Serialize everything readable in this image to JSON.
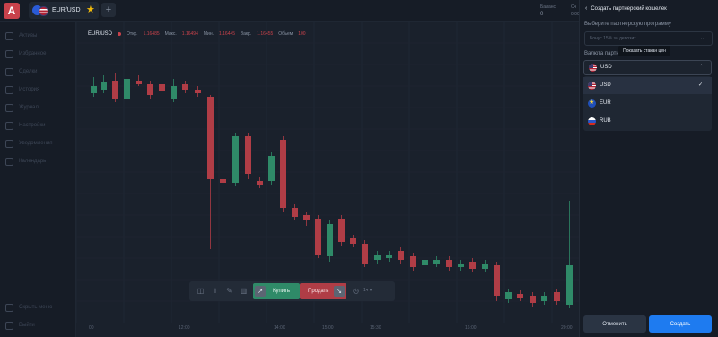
{
  "header": {
    "asset": "EUR/USD",
    "add_tab": "+",
    "balance_label": "Баланс",
    "balance_value": "0",
    "account_label": "Сч",
    "account_value": "0.00"
  },
  "sidebar": {
    "items": [
      {
        "label": "Активы",
        "icon": "assets-icon"
      },
      {
        "label": "Избранное",
        "icon": "favorites-icon"
      },
      {
        "label": "Сделки",
        "icon": "deals-icon"
      },
      {
        "label": "История",
        "icon": "history-icon"
      },
      {
        "label": "Журнал",
        "icon": "journal-icon"
      },
      {
        "label": "Настройки",
        "icon": "settings-icon"
      },
      {
        "label": "Уведомления",
        "icon": "notifications-icon"
      },
      {
        "label": "Календарь",
        "icon": "calendar-icon"
      }
    ],
    "bottom_items": [
      {
        "label": "Скрыть меню",
        "icon": "hide-menu-icon"
      },
      {
        "label": "Выйти",
        "icon": "logout-icon"
      }
    ]
  },
  "chart": {
    "symbol": "EUR/USD",
    "ohlc": [
      {
        "label": "Откр.",
        "value": "1.16485"
      },
      {
        "label": "Макс.",
        "value": "1.16494"
      },
      {
        "label": "Мин.",
        "value": "1.16445"
      },
      {
        "label": "Закр.",
        "value": "1.16455"
      },
      {
        "label": "Объем",
        "value": "100"
      }
    ],
    "x_labels": [
      "00",
      "12:00",
      "14:00",
      "15:00",
      "15:30",
      "16:00",
      "20:00"
    ],
    "colors": {
      "up": "#2f8a68",
      "down": "#b03d46"
    }
  },
  "trade": {
    "buy_label": "Купить",
    "sell_label": "Продать",
    "timeframe": "1ч"
  },
  "panel": {
    "title": "Создать партнерский кошелек",
    "program_label": "Выберите партнерскую программу",
    "program_placeholder": "Бонус 15% за депозит",
    "tooltip": "Показать стакан цен",
    "currency_label": "Валюта партнерского кошелька",
    "currency_selected": "USD",
    "currencies": [
      {
        "code": "USD",
        "selected": true
      },
      {
        "code": "EUR",
        "selected": false
      },
      {
        "code": "RUB",
        "selected": false
      }
    ],
    "cancel_label": "Отменить",
    "create_label": "Создать"
  }
}
